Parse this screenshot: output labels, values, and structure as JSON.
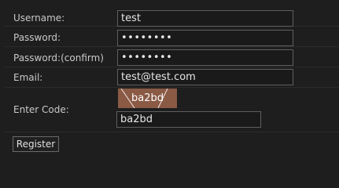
{
  "form": {
    "username": {
      "label": "Username:",
      "value": "test"
    },
    "password": {
      "label": "Password:",
      "value": "••••••••"
    },
    "password_confirm": {
      "label": "Password:(confirm)",
      "value": "••••••••"
    },
    "email": {
      "label": "Email:",
      "value": "test@test.com"
    },
    "code": {
      "label": "Enter Code:",
      "captcha_text": "ba2bd",
      "value": "ba2bd"
    },
    "register_label": "Register"
  },
  "colors": {
    "background": "#1e1e1e",
    "captcha_bg": "#8a5a45"
  }
}
